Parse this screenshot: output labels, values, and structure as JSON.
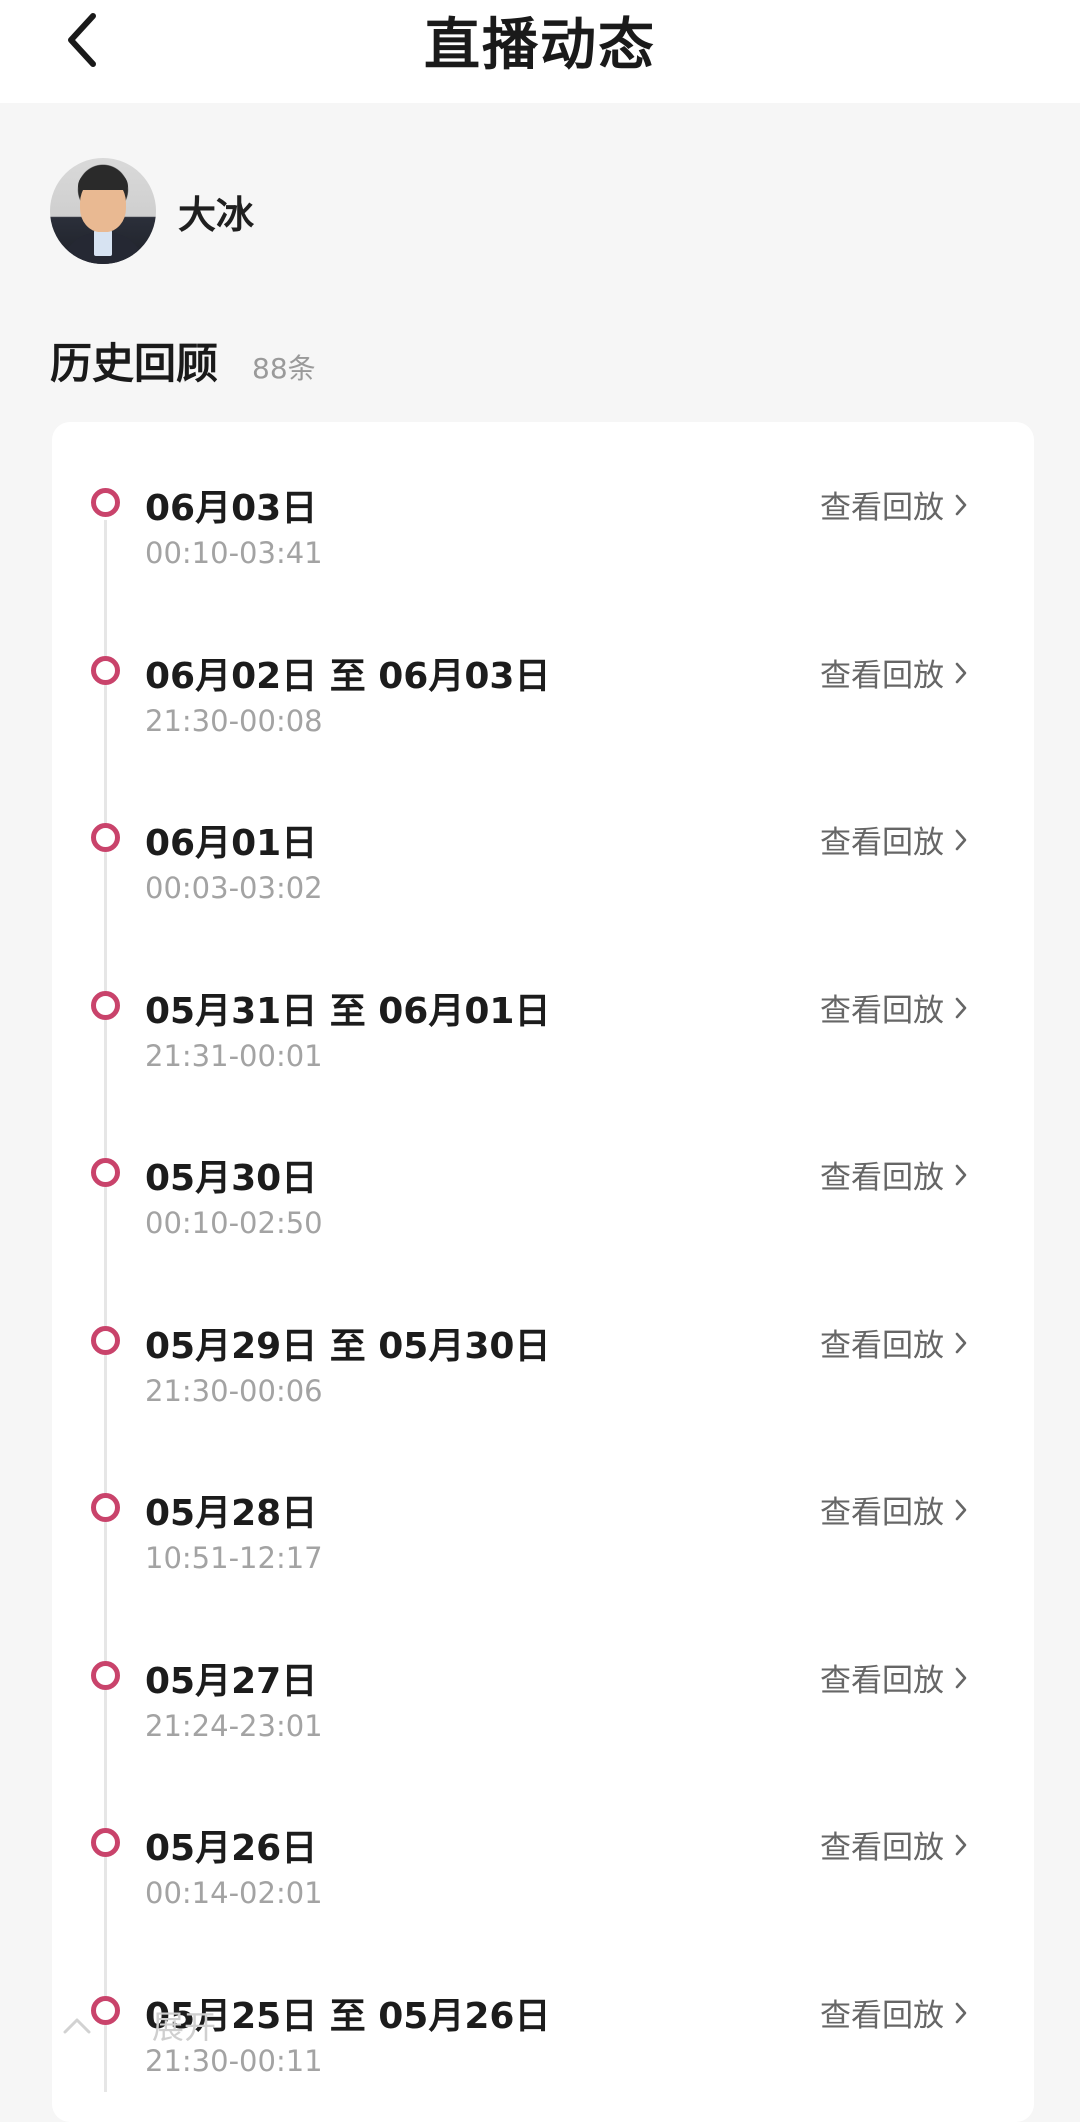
{
  "header": {
    "title": "直播动态",
    "back_icon": "chevron-left-icon"
  },
  "profile": {
    "name": "大冰"
  },
  "history": {
    "title": "历史回顾",
    "count": "88条"
  },
  "accent_color": "#c9436b",
  "items": [
    {
      "date": "06月03日",
      "time": "00:10-03:41",
      "action": "查看回放"
    },
    {
      "date": "06月02日 至 06月03日",
      "time": "21:30-00:08",
      "action": "查看回放"
    },
    {
      "date": "06月01日",
      "time": "00:03-03:02",
      "action": "查看回放"
    },
    {
      "date": "05月31日 至 06月01日",
      "time": "21:31-00:01",
      "action": "查看回放"
    },
    {
      "date": "05月30日",
      "time": "00:10-02:50",
      "action": "查看回放"
    },
    {
      "date": "05月29日 至 05月30日",
      "time": "21:30-00:06",
      "action": "查看回放"
    },
    {
      "date": "05月28日",
      "time": "10:51-12:17",
      "action": "查看回放"
    },
    {
      "date": "05月27日",
      "time": "21:24-23:01",
      "action": "查看回放"
    },
    {
      "date": "05月26日",
      "time": "00:14-02:01",
      "action": "查看回放"
    },
    {
      "date": "05月25日 至 05月26日",
      "time": "21:30-00:11",
      "action": "查看回放"
    }
  ],
  "expand_label": "展开"
}
